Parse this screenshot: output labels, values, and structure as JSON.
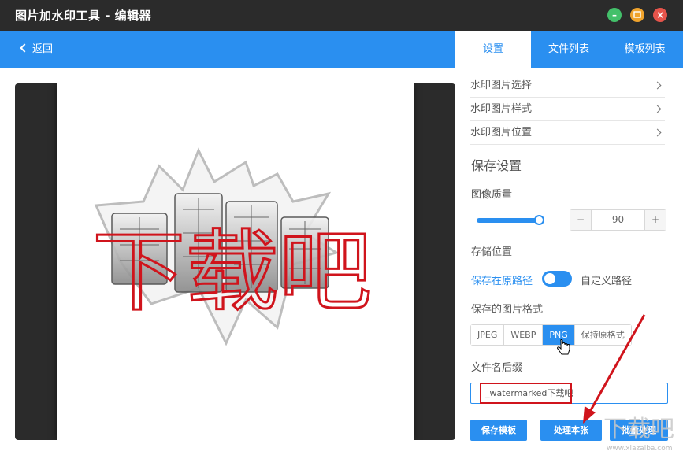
{
  "window": {
    "title": "图片加水印工具 - 编辑器"
  },
  "topbar": {
    "back_label": "返回",
    "tabs": [
      {
        "label": "设置",
        "active": true
      },
      {
        "label": "文件列表",
        "active": false
      },
      {
        "label": "模板列表",
        "active": false
      }
    ]
  },
  "canvas": {
    "watermark_text": "下载吧",
    "logo_text": "下载吧"
  },
  "settings": {
    "menu": [
      {
        "label": "水印图片选择"
      },
      {
        "label": "水印图片样式"
      },
      {
        "label": "水印图片位置"
      }
    ],
    "save_section_title": "保存设置",
    "quality": {
      "label": "图像质量",
      "value": "90",
      "minus": "−",
      "plus": "+",
      "slider_fraction": 0.9
    },
    "location": {
      "label": "存储位置",
      "left_option": "保存在原路径",
      "right_option": "自定义路径"
    },
    "format": {
      "label": "保存的图片格式",
      "options": [
        "JPEG",
        "WEBP",
        "PNG",
        "保持原格式"
      ],
      "selected": "PNG"
    },
    "suffix": {
      "label": "文件名后缀",
      "value": "_watermarked下载吧"
    },
    "buttons": {
      "save_template": "保存模板",
      "process_this": "处理本张",
      "batch_process": "批量处理"
    }
  },
  "colors": {
    "accent": "#2a8ff0",
    "titlebar": "#2b2b2b",
    "annotation_red": "#d0141c"
  },
  "site_watermark": {
    "text": "下载吧",
    "url": "www.xiazaiba.com"
  }
}
